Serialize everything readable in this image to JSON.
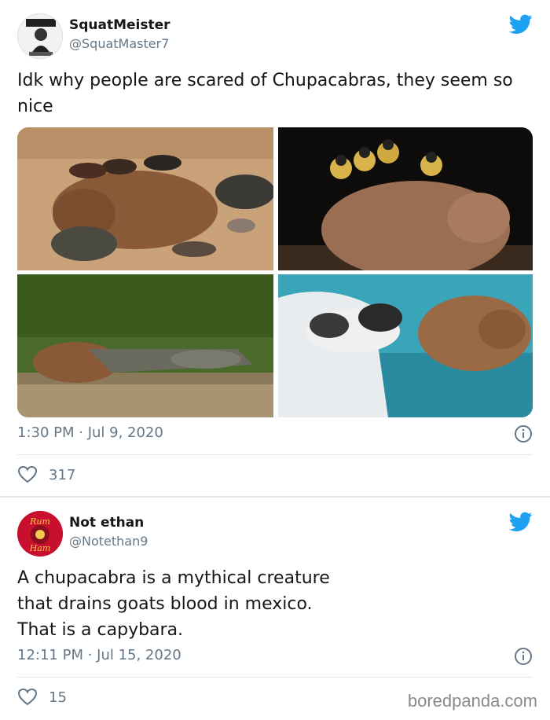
{
  "tweet1": {
    "display_name": "SquatMeister",
    "handle": "@SquatMaster7",
    "text": "Idk why people are scared of Chupacabras, they seem so nice",
    "timestamp": "1:30 PM · Jul 9, 2020",
    "likes": "317",
    "avatar_icon": "anime-avatar",
    "photos": [
      {
        "subject": "capybara-with-ducks-and-turtles-photo"
      },
      {
        "subject": "capybara-with-monkeys-photo"
      },
      {
        "subject": "capybara-with-crocodile-photo"
      },
      {
        "subject": "capybara-with-rat-photo"
      }
    ]
  },
  "tweet2": {
    "display_name": "Not ethan",
    "handle": "@Notethan9",
    "text_lines": [
      "A chupacabra is a mythical creature",
      "that drains goats blood in mexico.",
      "That is a capybara."
    ],
    "timestamp": "12:11 PM · Jul 15, 2020",
    "likes": "15",
    "avatar_icon": "rum-ham-avatar",
    "avatar_text_top": "Rum",
    "avatar_text_bottom": "Ham"
  },
  "watermark": "boredpanda.com",
  "colors": {
    "twitter_blue": "#1da1f2",
    "text_primary": "#14171a",
    "text_secondary": "#657786",
    "divider": "#e1e8ed"
  }
}
